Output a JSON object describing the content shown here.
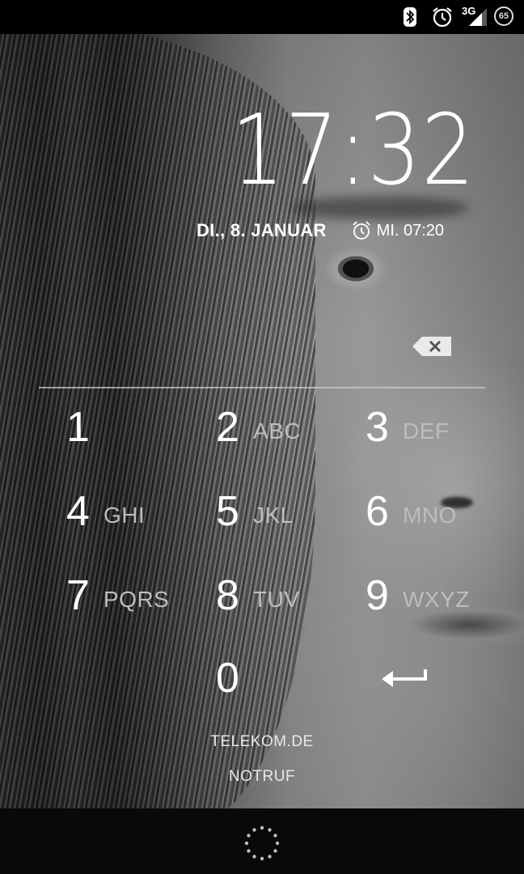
{
  "status_bar": {
    "icons": [
      "bluetooth-icon",
      "alarm-icon",
      "signal-icon",
      "battery-icon"
    ],
    "network_type": "3G",
    "battery_level": "65"
  },
  "lockscreen": {
    "time": "17:32",
    "date": "DI., 8. JANUAR",
    "next_alarm": "MI. 07:20"
  },
  "pin": {
    "value": "",
    "backspace_icon": "backspace-icon"
  },
  "keypad": {
    "keys": [
      {
        "digit": "1",
        "letters": ""
      },
      {
        "digit": "2",
        "letters": "ABC"
      },
      {
        "digit": "3",
        "letters": "DEF"
      },
      {
        "digit": "4",
        "letters": "GHI"
      },
      {
        "digit": "5",
        "letters": "JKL"
      },
      {
        "digit": "6",
        "letters": "MNO"
      },
      {
        "digit": "7",
        "letters": "PQRS"
      },
      {
        "digit": "8",
        "letters": "TUV"
      },
      {
        "digit": "9",
        "letters": "WXYZ"
      },
      {
        "digit": "0",
        "letters": ""
      }
    ],
    "enter_icon": "enter-arrow-icon"
  },
  "footer": {
    "carrier": "TELEKOM.DE",
    "emergency_label": "NOTRUF"
  },
  "colors": {
    "text": "#ffffff",
    "letters": "#bdbdbd",
    "bar_background": "#000000"
  }
}
